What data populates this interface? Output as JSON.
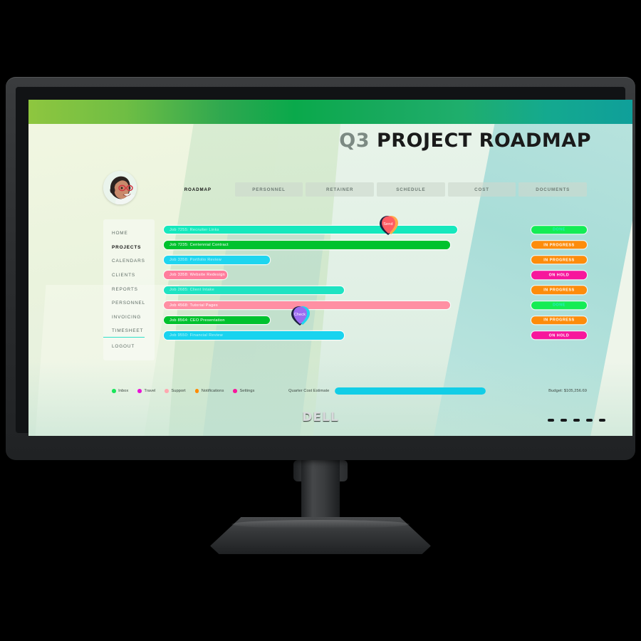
{
  "device": {
    "brand": "DELL"
  },
  "header": {
    "title_prefix": "Q3",
    "title_main": "PROJECT ROADMAP"
  },
  "tabs": [
    {
      "label": "ROADMAP",
      "active": true
    },
    {
      "label": "PERSONNEL",
      "active": false
    },
    {
      "label": "RETAINER",
      "active": false
    },
    {
      "label": "SCHEDULE",
      "active": false
    },
    {
      "label": "COST",
      "active": false
    },
    {
      "label": "DOCUMENTS",
      "active": false
    }
  ],
  "sidebar": {
    "items": [
      {
        "label": "HOME",
        "active": false
      },
      {
        "label": "PROJECTS",
        "active": true
      },
      {
        "label": "CALENDARS",
        "active": false
      },
      {
        "label": "CLIENTS",
        "active": false
      },
      {
        "label": "REPORTS",
        "active": false
      },
      {
        "label": "PERSONNEL",
        "active": false
      },
      {
        "label": "INVOICING",
        "active": false
      },
      {
        "label": "TIMESHEET",
        "active": false
      },
      {
        "label": "LOGOUT",
        "active": false
      }
    ]
  },
  "chart_data": {
    "type": "bar",
    "title": "Q3 Project Roadmap",
    "orientation": "horizontal",
    "xlabel": "",
    "ylabel": "",
    "categories": [
      "Job 7255: Recruiter Links",
      "Job 7235: Centennial Contract",
      "Job 3358: Portfolio Review",
      "Job 3358: Website Redesign",
      "Job 2685: Client Intake",
      "Job 4568: Tutorial Pages",
      "Job 8564: CEO Presentation",
      "Job 9550: Financial Review"
    ],
    "values": [
      83,
      81,
      30,
      18,
      51,
      81,
      30,
      51
    ],
    "xlim": [
      0,
      100
    ],
    "grid": false,
    "legend_position": "bottom-left",
    "bar_colors": [
      "#16e8bd",
      "#00c22e",
      "#1fd5ef",
      "#ff7d9c",
      "#1fe3c2",
      "#ff8fa3",
      "#00c22e",
      "#19d3ef"
    ],
    "statuses": [
      "DONE",
      "IN PROGRESS",
      "IN PROGRESS",
      "ON HOLD",
      "IN PROGRESS",
      "DONE",
      "IN PROGRESS",
      "ON HOLD"
    ]
  },
  "timeline": {
    "rows": [
      {
        "label": "Job 7255: Recruiter Links",
        "width_pct": 83,
        "color": "#16e8bd",
        "text_color": "rgba(255,255,255,0.72)",
        "status": "DONE",
        "status_color": "#14ec55"
      },
      {
        "label": "Job 7235: Centennial Contract",
        "width_pct": 81,
        "color": "#00c22e",
        "text_color": "#ffffff",
        "status": "IN PROGRESS",
        "status_color": "#fd8c0b"
      },
      {
        "label": "Job 3358: Portfolio Review",
        "width_pct": 30,
        "color": "#1fd5ef",
        "text_color": "rgba(255,255,255,0.7)",
        "status": "IN PROGRESS",
        "status_color": "#fd8c0b"
      },
      {
        "label": "Job 3358: Website Redesign",
        "width_pct": 18,
        "color": "#ff7d9c",
        "text_color": "#ffffff",
        "status": "ON HOLD",
        "status_color": "#f7169c"
      },
      {
        "label": "Job 2685: Client Intake",
        "width_pct": 51,
        "color": "#1fe3c2",
        "text_color": "rgba(255,255,255,0.7)",
        "status": "IN PROGRESS",
        "status_color": "#fd8c0b"
      },
      {
        "label": "Job 4568: Tutorial Pages",
        "width_pct": 81,
        "color": "#ff8fa3",
        "text_color": "#ffffff",
        "status": "DONE",
        "status_color": "#14ec55"
      },
      {
        "label": "Job 8564: CEO Presentation",
        "width_pct": 30,
        "color": "#00c22e",
        "text_color": "#ffffff",
        "status": "IN PROGRESS",
        "status_color": "#fd8c0b"
      },
      {
        "label": "Job 9550: Financial Review",
        "width_pct": 51,
        "color": "#19d3ef",
        "text_color": "rgba(255,255,255,0.7)",
        "status": "ON HOLD",
        "status_color": "#f7169c"
      }
    ]
  },
  "pins": [
    {
      "label": "Send",
      "left_pct": 63.5,
      "row": 0,
      "front": "#ff5c63",
      "mid": "#ffa84a",
      "back": "#1d2340"
    },
    {
      "label": "Check",
      "left_pct": 38.5,
      "row": 6,
      "front": "#9b6bf0",
      "mid": "#1fd5ef",
      "back": "#1d2340"
    }
  ],
  "footer": {
    "legend": [
      {
        "label": "Inbox",
        "color": "#19e55a"
      },
      {
        "label": "Travel",
        "color": "#e913d6"
      },
      {
        "label": "Support",
        "color": "#ffa8b0"
      },
      {
        "label": "Notifications",
        "color": "#ff8a00"
      },
      {
        "label": "Settings",
        "color": "#f7169c"
      }
    ],
    "cost_label": "Quarter Cost Estimate",
    "cost_fill_pct": 100,
    "budget_label": "Budget: $105,256.69"
  }
}
